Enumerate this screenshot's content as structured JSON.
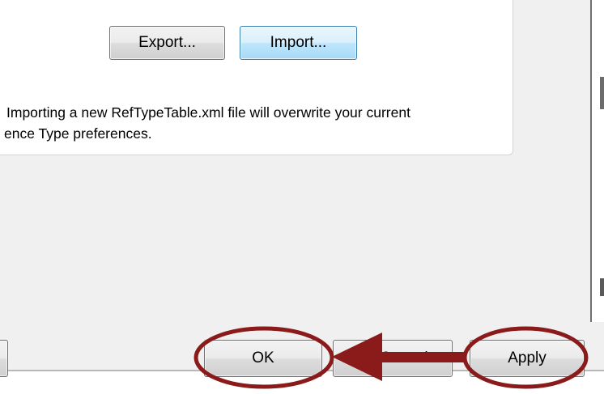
{
  "pane": {
    "export_label": "Export...",
    "import_label": "Import...",
    "note_line1": "Importing a new RefTypeTable.xml file will overwrite your current",
    "note_line2": "ence Type preferences."
  },
  "buttons": {
    "ok_label": "OK",
    "cancel_label": "Cancel",
    "apply_label": "Apply"
  },
  "annotation": {
    "highlight_color": "#8b1a1a",
    "arrow": "from Apply to OK"
  },
  "colors": {
    "dialog_background": "#f0f0f0",
    "pane_border": "#c9d6e4",
    "focus_border": "#3c7fb1"
  }
}
